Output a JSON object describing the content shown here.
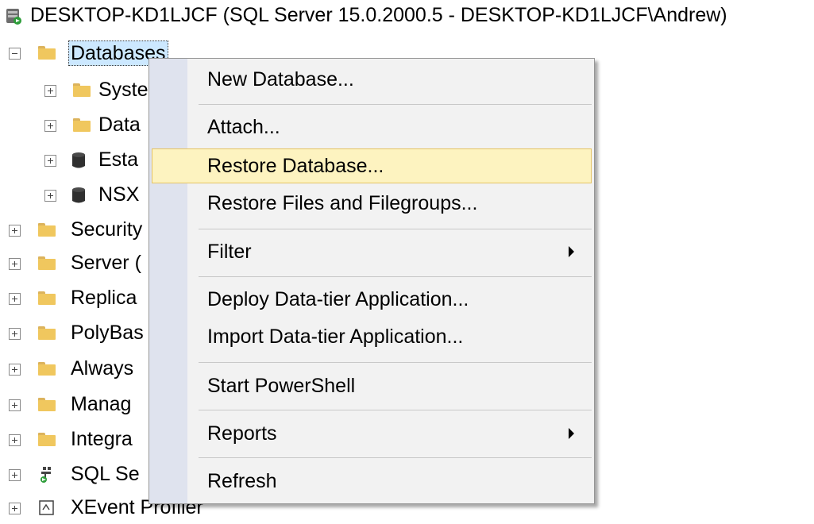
{
  "server": {
    "label": "DESKTOP-KD1LJCF (SQL Server 15.0.2000.5 - DESKTOP-KD1LJCF\\Andrew)"
  },
  "tree": {
    "databases": "Databases",
    "children": [
      "Syste",
      "Data",
      "Esta",
      "NSX"
    ],
    "top_items": [
      "Security",
      "Server (",
      "Replica",
      "PolyBas",
      "Always",
      "Manag",
      "Integra",
      "SQL Se",
      "XEvent Profiler"
    ]
  },
  "context_menu": {
    "items": [
      "New Database...",
      "Attach...",
      "Restore Database...",
      "Restore Files and Filegroups...",
      "Filter",
      "Deploy Data-tier Application...",
      "Import Data-tier Application...",
      "Start PowerShell",
      "Reports",
      "Refresh"
    ],
    "highlighted": "Restore Database..."
  },
  "colors": {
    "highlight_bg": "#fdf3c0",
    "highlight_border": "#e5c365",
    "selection_bg": "#cce8ff"
  }
}
